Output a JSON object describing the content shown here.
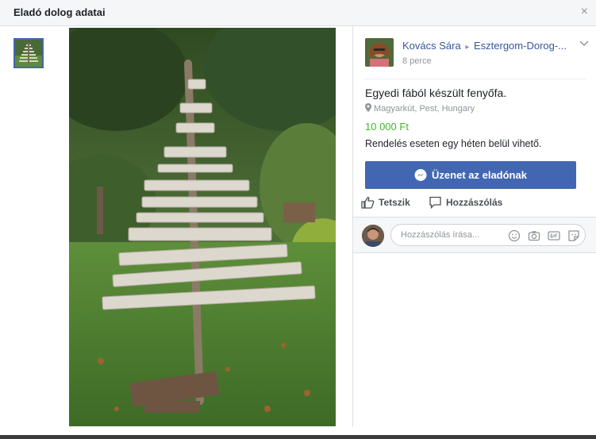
{
  "dialog": {
    "title": "Eladó dolog adatai",
    "close_symbol": "×"
  },
  "seller": {
    "name": "Kovács Sára",
    "group": "Esztergom-Dorog-...",
    "separator": "▸",
    "time": "8 perce"
  },
  "item": {
    "title": "Egyedi fából készült fenyőfa.",
    "location": "Magyarkút, Pest, Hungary",
    "price": "10 000 Ft",
    "description": "Rendelés eseten egy héten belül vihető."
  },
  "buttons": {
    "message": "Üzenet az eladónak",
    "like": "Tetszik",
    "comment": "Hozzászólás"
  },
  "comment_box": {
    "placeholder": "Hozzászólás írása..."
  },
  "icons": [
    "close-icon",
    "chevron-down-icon",
    "location-pin-icon",
    "messenger-icon",
    "like-icon",
    "comment-icon",
    "emoji-icon",
    "camera-icon",
    "gif-icon",
    "sticker-icon"
  ],
  "colors": {
    "accent": "#4267b2",
    "price": "#42b72a",
    "link": "#365899"
  }
}
